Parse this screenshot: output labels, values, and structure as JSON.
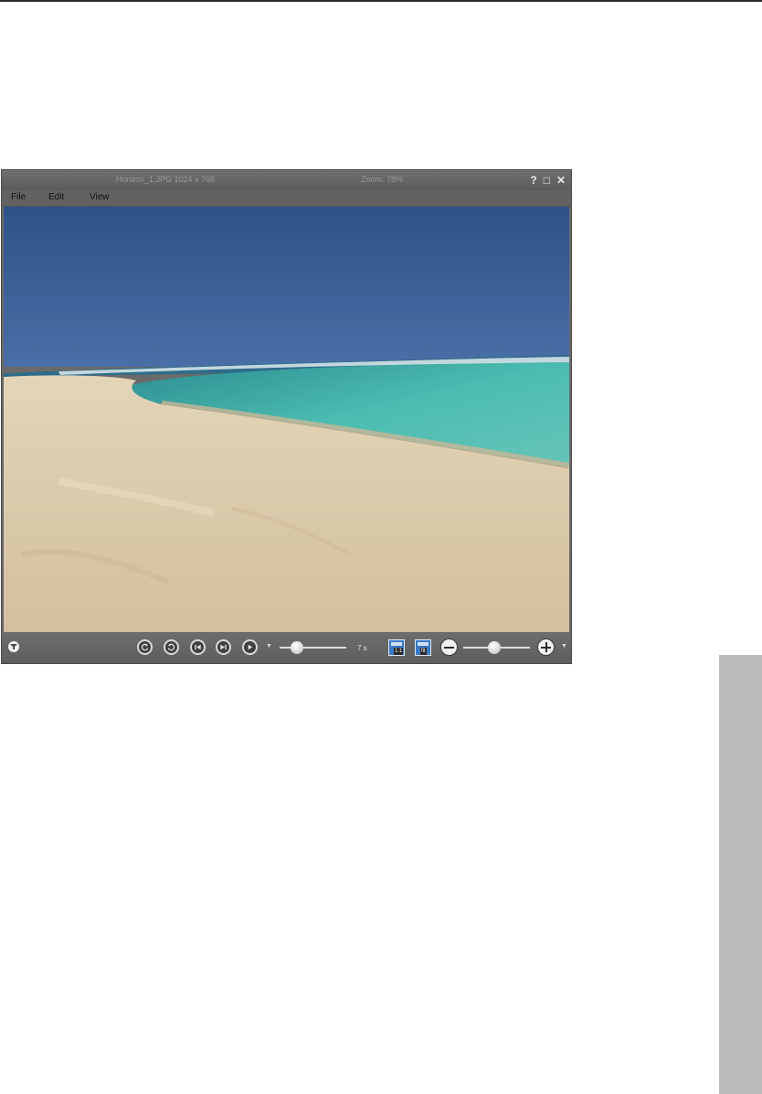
{
  "window": {
    "file_info": "Horizon_1.JPG 1024 x 768",
    "zoom_info": "Zoom: 78%",
    "help_symbol": "?",
    "maximize_symbol": "□",
    "close_symbol": "✕"
  },
  "menu": {
    "items": [
      {
        "label": "File"
      },
      {
        "label": "Edit"
      },
      {
        "label": "View"
      }
    ]
  },
  "photo": {
    "description_icon": "beach-photo",
    "sky_color": "#35598f",
    "sea_color": "#46b7ad",
    "sand_color": "#d9c8a9"
  },
  "toolbar": {
    "slideshow_speed": "7 s",
    "slideshow_dropdown_arrow": "▼",
    "zoom_dropdown_arrow": "▼",
    "actual_size_label": "1:1",
    "fit_label": "fit",
    "icons": [
      "filter-icon",
      "rotate-left-icon",
      "rotate-right-icon",
      "previous-icon",
      "next-icon",
      "play-icon",
      "zoom-out-icon",
      "zoom-in-icon"
    ],
    "speed_slider_level": 0.26,
    "zoom_slider_level": 0.47
  }
}
